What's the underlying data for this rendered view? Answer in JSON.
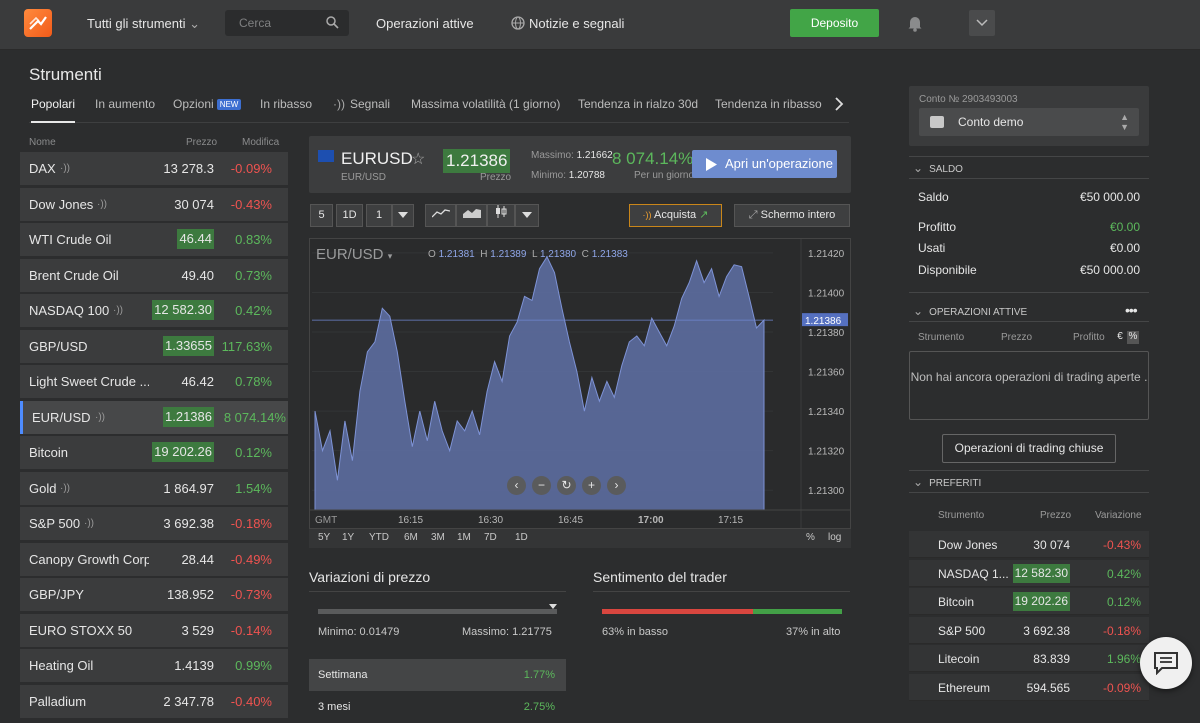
{
  "topbar": {
    "instruments_menu": "Tutti gli strumenti",
    "search_placeholder": "Cerca",
    "active_ops": "Operazioni attive",
    "news": "Notizie e segnali",
    "deposit": "Deposito"
  },
  "page_title": "Strumenti",
  "tabs": [
    "Popolari",
    "In aumento",
    "Opzioni",
    "In ribasso",
    "Segnali",
    "Massima volatilità (1 giorno)",
    "Tendenza in rialzo 30d",
    "Tendenza in ribasso"
  ],
  "tab_new_badge": "NEW",
  "list_head": {
    "name": "Nome",
    "price": "Prezzo",
    "change": "Modifica"
  },
  "instruments": [
    {
      "name": "DAX",
      "price": "13 278.3",
      "change": "-0.09%"
    },
    {
      "name": "Dow Jones",
      "price": "30 074",
      "change": "-0.43%"
    },
    {
      "name": "WTI Crude Oil",
      "price": "46.44",
      "change": "0.83%"
    },
    {
      "name": "Brent Crude Oil",
      "price": "49.40",
      "change": "0.73%"
    },
    {
      "name": "NASDAQ 100",
      "price": "12 582.30",
      "change": "0.42%"
    },
    {
      "name": "GBP/USD",
      "price": "1.33655",
      "change": "117.63%"
    },
    {
      "name": "Light Sweet Crude ...",
      "price": "46.42",
      "change": "0.78%"
    },
    {
      "name": "EUR/USD",
      "price": "1.21386",
      "change": "8 074.14%"
    },
    {
      "name": "Bitcoin",
      "price": "19 202.26",
      "change": "0.12%"
    },
    {
      "name": "Gold",
      "price": "1 864.97",
      "change": "1.54%"
    },
    {
      "name": "S&P 500",
      "price": "3 692.38",
      "change": "-0.18%"
    },
    {
      "name": "Canopy Growth Corp",
      "price": "28.44",
      "change": "-0.49%"
    },
    {
      "name": "GBP/JPY",
      "price": "138.952",
      "change": "-0.73%"
    },
    {
      "name": "EURO STOXX 50",
      "price": "3 529",
      "change": "-0.14%"
    },
    {
      "name": "Heating Oil",
      "price": "1.4139",
      "change": "0.99%"
    },
    {
      "name": "Palladium",
      "price": "2 347.78",
      "change": "-0.40%"
    }
  ],
  "header": {
    "symbol": "EURUSD",
    "sub": "EUR/USD",
    "price": "1.21386",
    "price_label": "Prezzo",
    "max_label": "Massimo:",
    "max": "1.21662",
    "min_label": "Minimo:",
    "min": "1.20788",
    "pct": "8 074.14%",
    "pct_label": "Per un giorno",
    "trade": "Apri un'operazione"
  },
  "toolbar": {
    "interval": "5",
    "period": "1D",
    "count": "1",
    "buy": "Acquista",
    "fullscreen": "Schermo intero"
  },
  "chart_data": {
    "type": "area",
    "symbol": "EUR/USD",
    "ohlc": {
      "O": "1.21381",
      "H": "1.21389",
      "L": "1.21380",
      "C": "1.21383"
    },
    "current_label": "1.21386",
    "y_ticks": [
      "1.21420",
      "1.21400",
      "1.21380",
      "1.21360",
      "1.21340",
      "1.21320",
      "1.21300"
    ],
    "x_ticks": [
      "16:15",
      "16:30",
      "16:45",
      "17:00",
      "17:15"
    ],
    "x_start": "GMT",
    "ylim": [
      1.2129,
      1.21425
    ],
    "values": [
      1.2134,
      1.2132,
      1.2133,
      1.21305,
      1.21335,
      1.21315,
      1.2135,
      1.2137,
      1.21375,
      1.21392,
      1.21388,
      1.2137,
      1.21345,
      1.21322,
      1.2134,
      1.21325,
      1.21345,
      1.2133,
      1.2132,
      1.21335,
      1.2133,
      1.2134,
      1.21328,
      1.2135,
      1.21365,
      1.21355,
      1.21378,
      1.21385,
      1.21398,
      1.21396,
      1.21412,
      1.21418,
      1.2141,
      1.21392,
      1.21375,
      1.2136,
      1.2134,
      1.21357,
      1.21345,
      1.21355,
      1.21347,
      1.21363,
      1.21375,
      1.21378,
      1.21373,
      1.21387,
      1.2138,
      1.21373,
      1.21383,
      1.21397,
      1.21405,
      1.21416,
      1.21405,
      1.21412,
      1.21398,
      1.21408,
      1.21414,
      1.21413,
      1.21398,
      1.21382,
      1.21386
    ]
  },
  "ranges": [
    "5Y",
    "1Y",
    "YTD",
    "6M",
    "3M",
    "1M",
    "7D",
    "1D"
  ],
  "scale_opts": [
    "%",
    "log"
  ],
  "price_changes": {
    "title": "Variazioni di prezzo",
    "min_label": "Minimo: 0.01479",
    "max_label": "Massimo: 1.21775",
    "rows": [
      {
        "label": "Settimana",
        "value": "1.77%"
      },
      {
        "label": "3 mesi",
        "value": "2.75%"
      }
    ]
  },
  "sentiment": {
    "title": "Sentimento del trader",
    "down_pct": 63,
    "up_pct": 37,
    "down_label": "63% in basso",
    "up_label": "37% in alto"
  },
  "account": {
    "number": "Conto № 2903493003",
    "type": "Conto demo"
  },
  "balance": {
    "title": "SALDO",
    "rows": [
      {
        "label": "Saldo",
        "value": "€50 000.00"
      },
      {
        "label": "Profitto",
        "value": "€0.00"
      },
      {
        "label": "Usati",
        "value": "€0.00"
      },
      {
        "label": "Disponibile",
        "value": "€50 000.00"
      }
    ]
  },
  "active": {
    "title": "OPERAZIONI ATTIVE",
    "col_instr": "Strumento",
    "col_price": "Prezzo",
    "col_profit": "Profitto",
    "currency_btn": "€",
    "pct_btn": "%",
    "empty": "Non hai ancora operazioni di trading aperte .",
    "closed_btn": "Operazioni di trading chiuse"
  },
  "favorites": {
    "title": "PREFERITI",
    "col_instr": "Strumento",
    "col_price": "Prezzo",
    "col_change": "Variazione",
    "rows": [
      {
        "name": "Dow Jones",
        "price": "30 074",
        "change": "-0.43%"
      },
      {
        "name": "NASDAQ 1...",
        "price": "12 582.30",
        "change": "0.42%"
      },
      {
        "name": "Bitcoin",
        "price": "19 202.26",
        "change": "0.12%"
      },
      {
        "name": "S&P 500",
        "price": "3 692.38",
        "change": "-0.18%"
      },
      {
        "name": "Litecoin",
        "price": "83.839",
        "change": "1.96%"
      },
      {
        "name": "Ethereum",
        "price": "594.565",
        "change": "-0.09%"
      }
    ]
  }
}
